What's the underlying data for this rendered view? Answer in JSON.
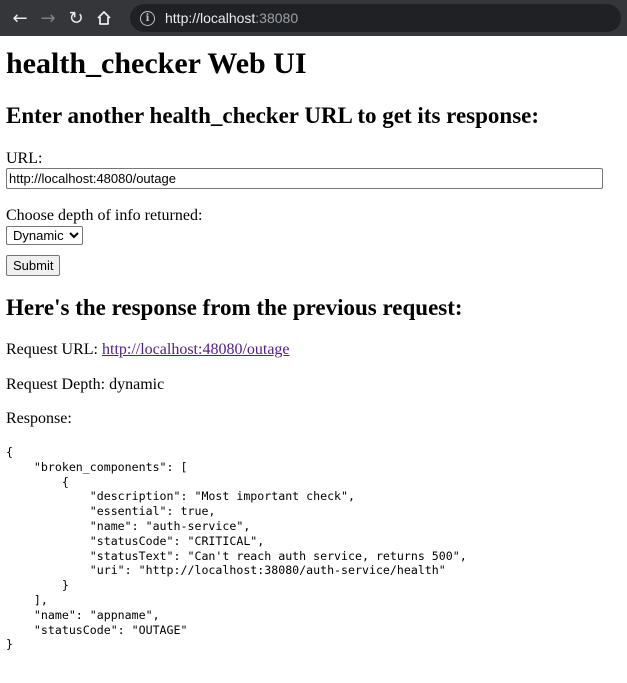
{
  "browser": {
    "url_host": "http://localhost",
    "url_port": ":38080"
  },
  "page": {
    "title": "health_checker Web UI",
    "form_heading": "Enter another health_checker URL to get its response:",
    "url_label": "URL:",
    "url_value": "http://localhost:48080/outage",
    "depth_label": "Choose depth of info returned:",
    "depth_selected": "Dynamic",
    "submit_label": "Submit",
    "response_heading": "Here's the response from the previous request:",
    "request_url_label": "Request URL:",
    "request_url_link": "http://localhost:48080/outage",
    "request_depth_label": "Request Depth:",
    "request_depth_value": "dynamic",
    "response_label": "Response:",
    "response_body": "{\n    \"broken_components\": [\n        {\n            \"description\": \"Most important check\",\n            \"essential\": true,\n            \"name\": \"auth-service\",\n            \"statusCode\": \"CRITICAL\",\n            \"statusText\": \"Can't reach auth service, returns 500\",\n            \"uri\": \"http://localhost:38080/auth-service/health\"\n        }\n    ],\n    \"name\": \"appname\",\n    \"statusCode\": \"OUTAGE\"\n}"
  }
}
